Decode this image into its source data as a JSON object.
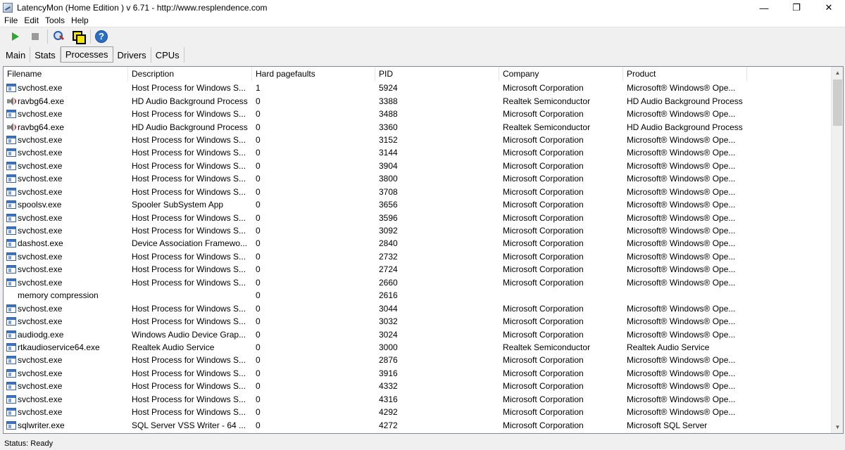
{
  "window": {
    "title": "LatencyMon  (Home Edition )  v 6.71 - http://www.resplendence.com",
    "minimize": "—",
    "maximize": "❐",
    "close": "✕"
  },
  "menu": [
    "File",
    "Edit",
    "Tools",
    "Help"
  ],
  "toolbar": {
    "icons": [
      "play-icon",
      "stop-icon",
      "tools-icon",
      "windows-icon",
      "help-icon"
    ],
    "help_glyph": "?"
  },
  "tabs": [
    {
      "label": "Main",
      "active": false
    },
    {
      "label": "Stats",
      "active": false
    },
    {
      "label": "Processes",
      "active": true
    },
    {
      "label": "Drivers",
      "active": false
    },
    {
      "label": "CPUs",
      "active": false
    }
  ],
  "columns": [
    "Filename",
    "Description",
    "Hard pagefaults",
    "PID",
    "Company",
    "Product"
  ],
  "rows": [
    {
      "icon": "window",
      "file": "svchost.exe",
      "desc": "Host Process for Windows S...",
      "hpf": "1",
      "pid": "5924",
      "comp": "Microsoft Corporation",
      "prod": "Microsoft® Windows® Ope..."
    },
    {
      "icon": "speaker",
      "file": "ravbg64.exe",
      "desc": "HD Audio Background Process",
      "hpf": "0",
      "pid": "3388",
      "comp": "Realtek Semiconductor",
      "prod": "HD Audio Background Process"
    },
    {
      "icon": "window",
      "file": "svchost.exe",
      "desc": "Host Process for Windows S...",
      "hpf": "0",
      "pid": "3488",
      "comp": "Microsoft Corporation",
      "prod": "Microsoft® Windows® Ope..."
    },
    {
      "icon": "speaker",
      "file": "ravbg64.exe",
      "desc": "HD Audio Background Process",
      "hpf": "0",
      "pid": "3360",
      "comp": "Realtek Semiconductor",
      "prod": "HD Audio Background Process"
    },
    {
      "icon": "window",
      "file": "svchost.exe",
      "desc": "Host Process for Windows S...",
      "hpf": "0",
      "pid": "3152",
      "comp": "Microsoft Corporation",
      "prod": "Microsoft® Windows® Ope..."
    },
    {
      "icon": "window",
      "file": "svchost.exe",
      "desc": "Host Process for Windows S...",
      "hpf": "0",
      "pid": "3144",
      "comp": "Microsoft Corporation",
      "prod": "Microsoft® Windows® Ope..."
    },
    {
      "icon": "window",
      "file": "svchost.exe",
      "desc": "Host Process for Windows S...",
      "hpf": "0",
      "pid": "3904",
      "comp": "Microsoft Corporation",
      "prod": "Microsoft® Windows® Ope..."
    },
    {
      "icon": "window",
      "file": "svchost.exe",
      "desc": "Host Process for Windows S...",
      "hpf": "0",
      "pid": "3800",
      "comp": "Microsoft Corporation",
      "prod": "Microsoft® Windows® Ope..."
    },
    {
      "icon": "window",
      "file": "svchost.exe",
      "desc": "Host Process for Windows S...",
      "hpf": "0",
      "pid": "3708",
      "comp": "Microsoft Corporation",
      "prod": "Microsoft® Windows® Ope..."
    },
    {
      "icon": "window",
      "file": "spoolsv.exe",
      "desc": "Spooler SubSystem App",
      "hpf": "0",
      "pid": "3656",
      "comp": "Microsoft Corporation",
      "prod": "Microsoft® Windows® Ope..."
    },
    {
      "icon": "window",
      "file": "svchost.exe",
      "desc": "Host Process for Windows S...",
      "hpf": "0",
      "pid": "3596",
      "comp": "Microsoft Corporation",
      "prod": "Microsoft® Windows® Ope..."
    },
    {
      "icon": "window",
      "file": "svchost.exe",
      "desc": "Host Process for Windows S...",
      "hpf": "0",
      "pid": "3092",
      "comp": "Microsoft Corporation",
      "prod": "Microsoft® Windows® Ope..."
    },
    {
      "icon": "window",
      "file": "dashost.exe",
      "desc": "Device Association Framewo...",
      "hpf": "0",
      "pid": "2840",
      "comp": "Microsoft Corporation",
      "prod": "Microsoft® Windows® Ope..."
    },
    {
      "icon": "window",
      "file": "svchost.exe",
      "desc": "Host Process for Windows S...",
      "hpf": "0",
      "pid": "2732",
      "comp": "Microsoft Corporation",
      "prod": "Microsoft® Windows® Ope..."
    },
    {
      "icon": "window",
      "file": "svchost.exe",
      "desc": "Host Process for Windows S...",
      "hpf": "0",
      "pid": "2724",
      "comp": "Microsoft Corporation",
      "prod": "Microsoft® Windows® Ope..."
    },
    {
      "icon": "window",
      "file": "svchost.exe",
      "desc": "Host Process for Windows S...",
      "hpf": "0",
      "pid": "2660",
      "comp": "Microsoft Corporation",
      "prod": "Microsoft® Windows® Ope..."
    },
    {
      "icon": "blank",
      "file": "memory compression",
      "desc": "",
      "hpf": "0",
      "pid": "2616",
      "comp": "",
      "prod": ""
    },
    {
      "icon": "window",
      "file": "svchost.exe",
      "desc": "Host Process for Windows S...",
      "hpf": "0",
      "pid": "3044",
      "comp": "Microsoft Corporation",
      "prod": "Microsoft® Windows® Ope..."
    },
    {
      "icon": "window",
      "file": "svchost.exe",
      "desc": "Host Process for Windows S...",
      "hpf": "0",
      "pid": "3032",
      "comp": "Microsoft Corporation",
      "prod": "Microsoft® Windows® Ope..."
    },
    {
      "icon": "window",
      "file": "audiodg.exe",
      "desc": "Windows Audio Device Grap...",
      "hpf": "0",
      "pid": "3024",
      "comp": "Microsoft Corporation",
      "prod": "Microsoft® Windows® Ope..."
    },
    {
      "icon": "window",
      "file": "rtkaudioservice64.exe",
      "desc": "Realtek Audio Service",
      "hpf": "0",
      "pid": "3000",
      "comp": "Realtek Semiconductor",
      "prod": "Realtek Audio Service"
    },
    {
      "icon": "window",
      "file": "svchost.exe",
      "desc": "Host Process for Windows S...",
      "hpf": "0",
      "pid": "2876",
      "comp": "Microsoft Corporation",
      "prod": "Microsoft® Windows® Ope..."
    },
    {
      "icon": "window",
      "file": "svchost.exe",
      "desc": "Host Process for Windows S...",
      "hpf": "0",
      "pid": "3916",
      "comp": "Microsoft Corporation",
      "prod": "Microsoft® Windows® Ope..."
    },
    {
      "icon": "window",
      "file": "svchost.exe",
      "desc": "Host Process for Windows S...",
      "hpf": "0",
      "pid": "4332",
      "comp": "Microsoft Corporation",
      "prod": "Microsoft® Windows® Ope..."
    },
    {
      "icon": "window",
      "file": "svchost.exe",
      "desc": "Host Process for Windows S...",
      "hpf": "0",
      "pid": "4316",
      "comp": "Microsoft Corporation",
      "prod": "Microsoft® Windows® Ope..."
    },
    {
      "icon": "window",
      "file": "svchost.exe",
      "desc": "Host Process for Windows S...",
      "hpf": "0",
      "pid": "4292",
      "comp": "Microsoft Corporation",
      "prod": "Microsoft® Windows® Ope..."
    },
    {
      "icon": "window",
      "file": "sqlwriter.exe",
      "desc": "SQL Server VSS Writer - 64 ...",
      "hpf": "0",
      "pid": "4272",
      "comp": "Microsoft Corporation",
      "prod": "Microsoft SQL Server"
    }
  ],
  "status": "Status: Ready"
}
